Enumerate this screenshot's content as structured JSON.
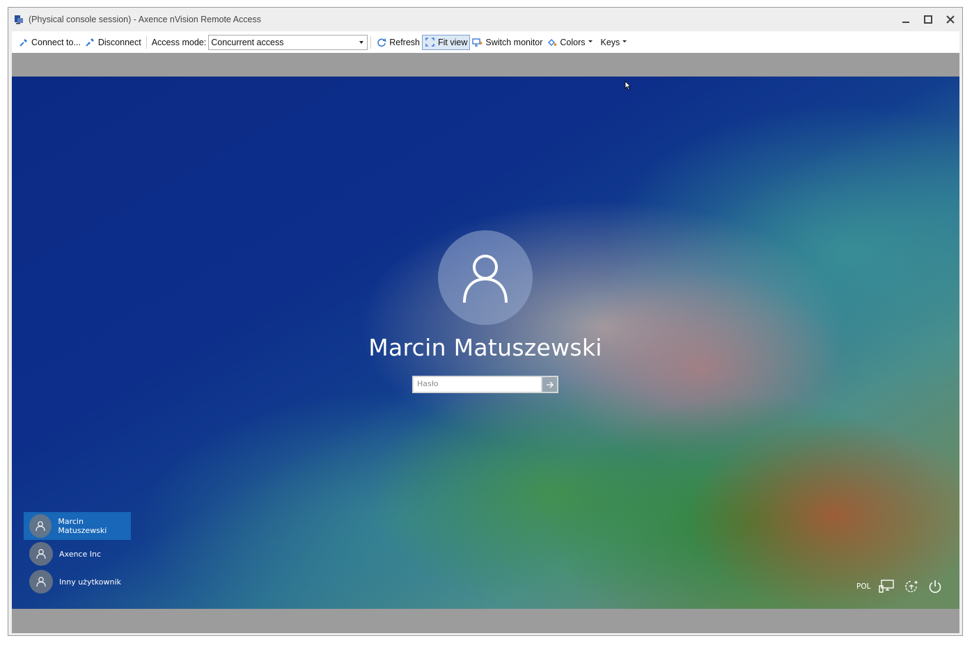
{
  "window": {
    "title": "(Physical console session) - Axence nVision Remote Access"
  },
  "toolbar": {
    "connect_label": "Connect to...",
    "disconnect_label": "Disconnect",
    "access_mode_label": "Access mode:",
    "access_mode_value": "Concurrent access",
    "refresh_label": "Refresh",
    "fit_view_label": "Fit view",
    "switch_monitor_label": "Switch monitor",
    "colors_label": "Colors",
    "keys_label": "Keys"
  },
  "login": {
    "user_name": "Marcin Matuszewski",
    "password_placeholder": "Hasło"
  },
  "user_list": [
    {
      "name": "Marcin Matuszewski",
      "selected": true
    },
    {
      "name": "Axence Inc",
      "selected": false
    },
    {
      "name": "Inny użytkownik",
      "selected": false
    }
  ],
  "system_tray": {
    "language": "POL",
    "icons": [
      "network-icon",
      "ease-of-access-icon",
      "power-icon"
    ]
  },
  "colors": {
    "selected_user": "#1867b8",
    "fit_view_highlight": "#dce8f5"
  }
}
